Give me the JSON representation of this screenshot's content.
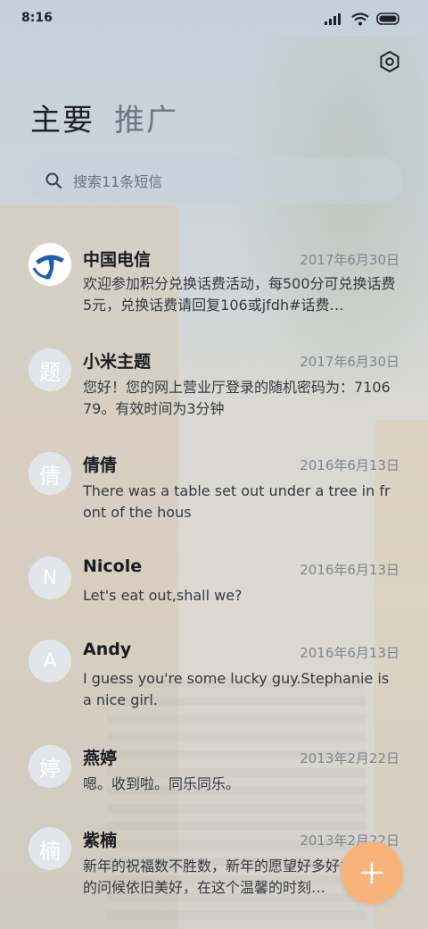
{
  "status_bar": {
    "time": "8:16",
    "icons": [
      "signal-icon",
      "wifi-icon",
      "battery-icon"
    ]
  },
  "header": {
    "settings_icon": "gear-icon",
    "tabs": [
      {
        "label": "主要",
        "active": true
      },
      {
        "label": "推广",
        "active": false
      }
    ]
  },
  "search": {
    "placeholder": "搜索11条短信"
  },
  "conversations": [
    {
      "avatar": "logo",
      "avatar_text": "",
      "name": "中国电信",
      "date": "2017年6月30日",
      "preview": "欢迎参加积分兑换话费活动，每500分可兑换话费5元，兑换话费请回复106或jfdh#话费…"
    },
    {
      "avatar": "text",
      "avatar_text": "题",
      "name": "小米主题",
      "date": "2017年6月30日",
      "preview": "您好！您的网上营业厅登录的随机密码为：710679。有效时间为3分钟"
    },
    {
      "avatar": "text",
      "avatar_text": "倩",
      "name": "倩倩",
      "date": "2016年6月13日",
      "preview": "There was a table set out under a tree in front of the hous"
    },
    {
      "avatar": "letter",
      "avatar_text": "N",
      "name": "Nicole",
      "date": "2016年6月13日",
      "preview": "Let's eat out,shall we?"
    },
    {
      "avatar": "letter",
      "avatar_text": "A",
      "name": "Andy",
      "date": "2016年6月13日",
      "preview": "I guess you're some lucky guy.Stephanie is a nice girl."
    },
    {
      "avatar": "text",
      "avatar_text": "婷",
      "name": "燕婷",
      "date": "2013年2月22日",
      "preview": "嗯。收到啦。同乐同乐。"
    },
    {
      "avatar": "text",
      "avatar_text": "楠",
      "name": "紫楠",
      "date": "2013年2月22日",
      "preview": "新年的祝福数不胜数，新年的愿望好多好多，新年的问候依旧美好，在这个温馨的时刻…"
    }
  ],
  "fab": {
    "icon": "plus-icon"
  },
  "colors": {
    "fab": "#f8b27c",
    "telecom_blue": "#1d5fb0",
    "text_primary": "#1a1c20",
    "text_secondary": "#7d8790"
  }
}
